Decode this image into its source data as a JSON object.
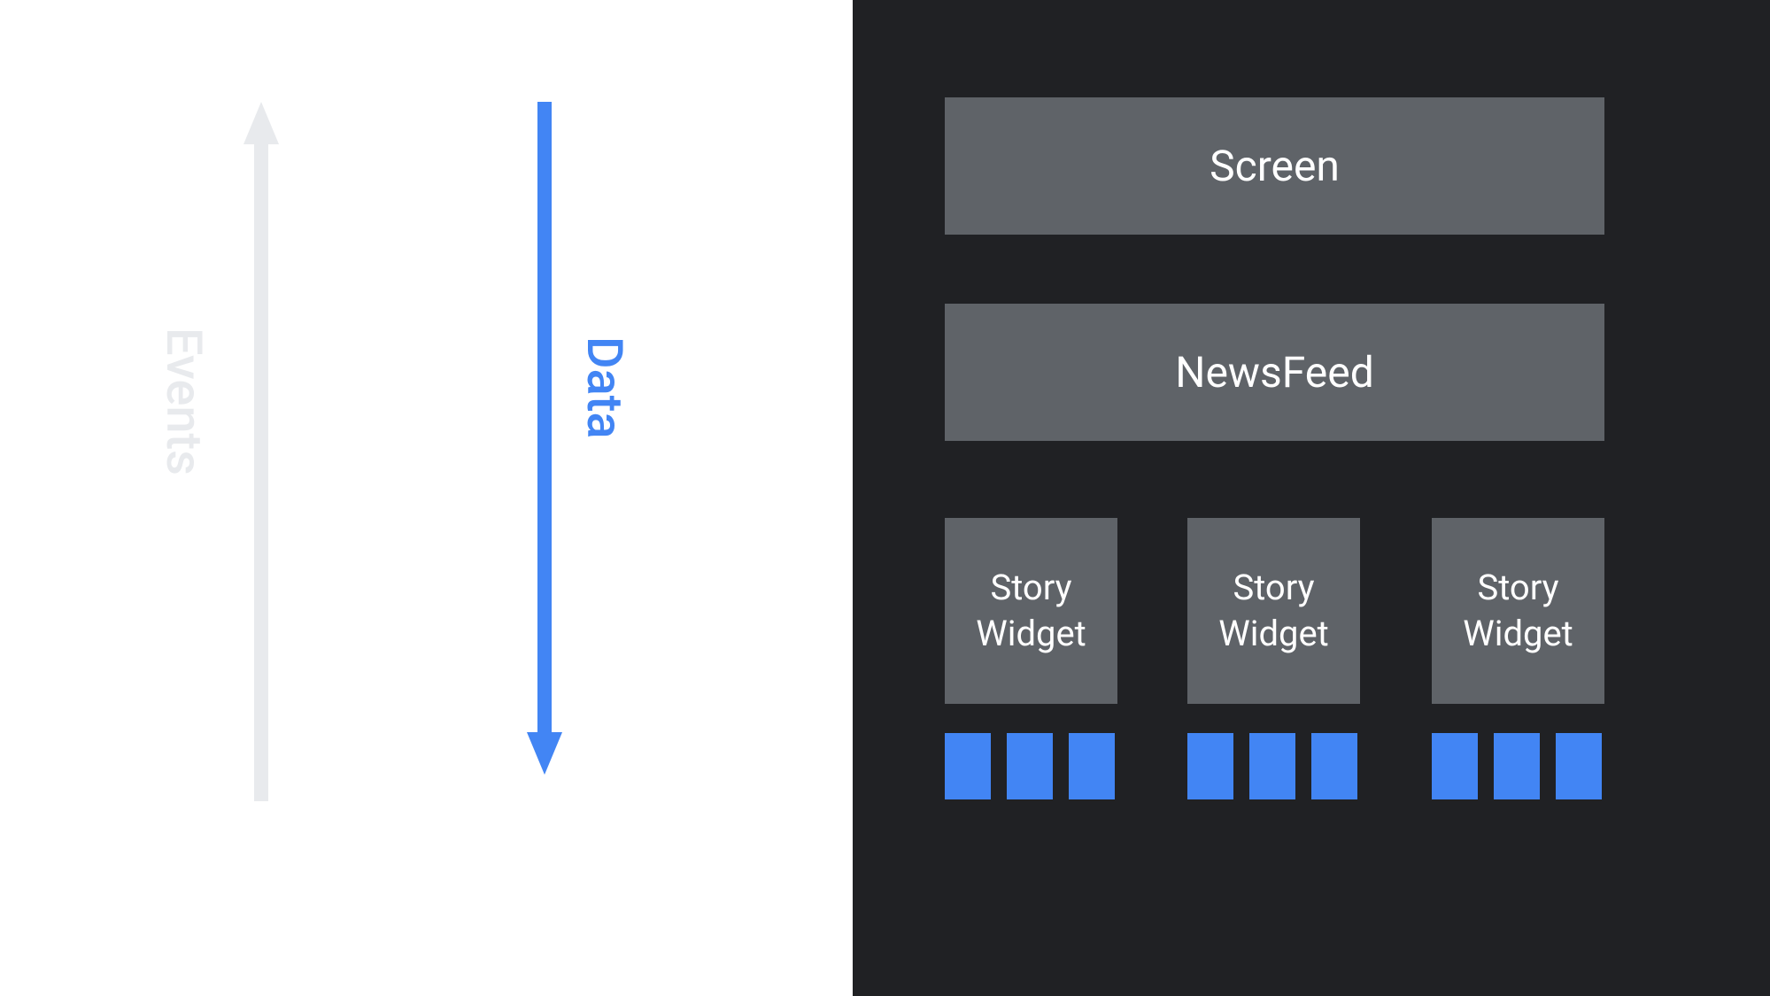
{
  "left_panel": {
    "events_arrow": {
      "label": "Events",
      "color": "#e8eaed",
      "direction": "up"
    },
    "data_arrow": {
      "label": "Data",
      "color": "#4285f4",
      "direction": "down"
    }
  },
  "right_panel": {
    "background": "#202124",
    "screen_box": {
      "label": "Screen"
    },
    "newsfeed_box": {
      "label": "NewsFeed"
    },
    "story_widgets": [
      {
        "label": "Story\nWidget"
      },
      {
        "label": "Story\nWidget"
      },
      {
        "label": "Story\nWidget"
      }
    ],
    "blue_rect_count_per_group": 3,
    "blue_rect_groups": 3,
    "blue_rect_color": "#4285f4"
  }
}
